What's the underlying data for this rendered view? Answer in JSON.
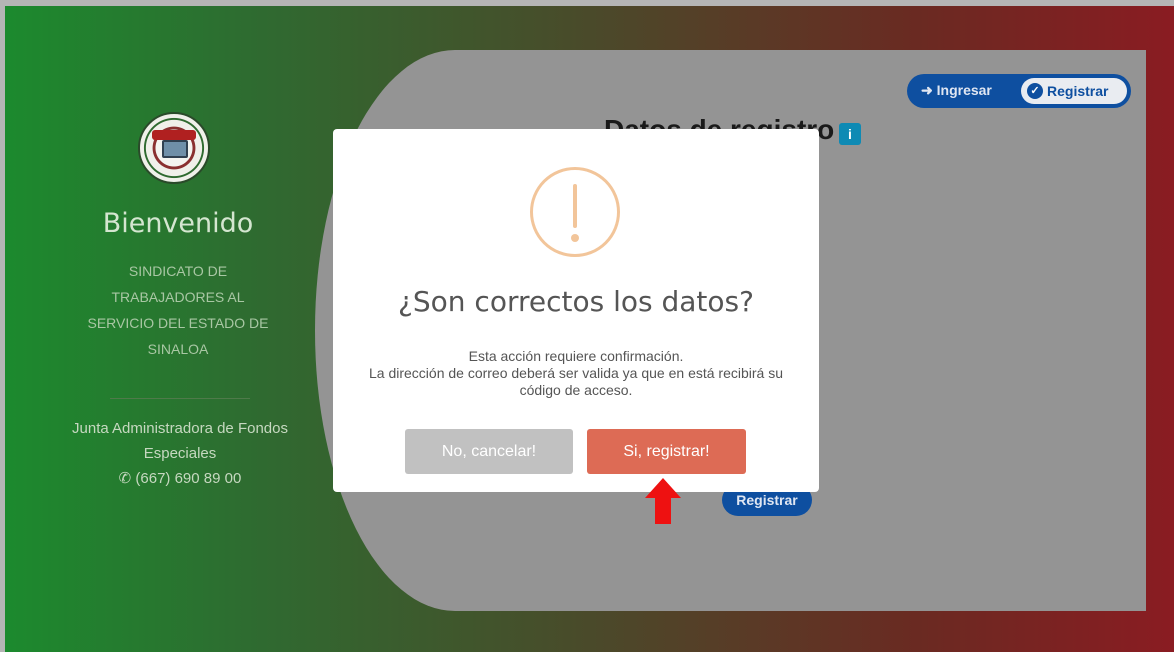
{
  "sidebar": {
    "welcome": "Bienvenido",
    "union_name": "SINDICATO DE TRABAJADORES AL SERVICIO DEL ESTADO DE SINALOA",
    "junta": "Junta Administradora de Fondos Especiales",
    "phone": "(667) 690 89 00"
  },
  "form": {
    "title": "Datos de registro",
    "info_badge": "i",
    "submit_label": "Registrar"
  },
  "toggle": {
    "ingresar": "Ingresar",
    "registrar": "Registrar"
  },
  "modal": {
    "title": "¿Son correctos los datos?",
    "line1": "Esta acción requiere confirmación.",
    "line2": "La dirección de correo deberá ser valida ya que en está recibirá su código de acceso.",
    "cancel_label": "No, cancelar!",
    "confirm_label": "Si, registrar!"
  },
  "colors": {
    "confirm": "#dd6b55",
    "cancel": "#c1c1c1",
    "toggle": "#0e4fa0",
    "warning": "#f2c59a",
    "arrow": "#ee1111"
  }
}
